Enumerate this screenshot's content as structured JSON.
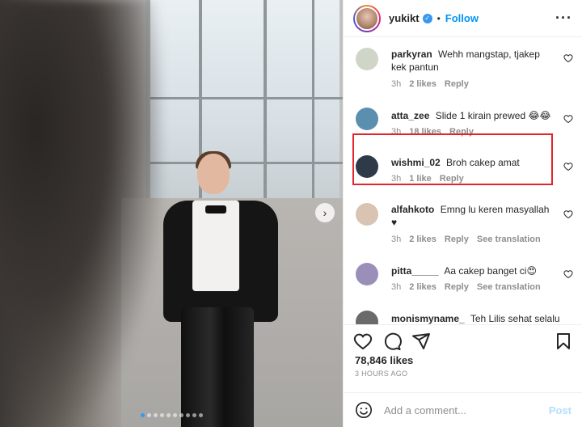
{
  "media": {
    "next_icon": "chevron-right-icon",
    "slide_count": 10,
    "active_slide": 1
  },
  "header": {
    "username": "yukikt",
    "verified_mark": "✓",
    "separator": "•",
    "follow_label": "Follow",
    "more_icon": "···"
  },
  "comments": [
    {
      "user": "parkyran",
      "text": "Wehh mangstap, tjakep kek pantun",
      "time": "3h",
      "likes": "2 likes",
      "reply": "Reply",
      "translate": "",
      "avatar_color": "#cfd6c8"
    },
    {
      "user": "atta_zee",
      "text": "Slide 1 kirain prewed 😂😂",
      "time": "3h",
      "likes": "18 likes",
      "reply": "Reply",
      "translate": "",
      "avatar_color": "#5b8fb0"
    },
    {
      "user": "wishmi_02",
      "text": "Broh cakep amat",
      "time": "3h",
      "likes": "1 like",
      "reply": "Reply",
      "translate": "",
      "avatar_color": "#2e3a48"
    },
    {
      "user": "alfahkoto",
      "text": "Emng lu keren masyallah ♥",
      "time": "3h",
      "likes": "2 likes",
      "reply": "Reply",
      "translate": "See translation",
      "avatar_color": "#d9c4b3"
    },
    {
      "user": "pitta_____",
      "text": "Aa cakep banget ci😍",
      "time": "3h",
      "likes": "2 likes",
      "reply": "Reply",
      "translate": "See translation",
      "avatar_color": "#9a8fb8"
    },
    {
      "user": "monismyname_",
      "text": "Teh Lilis sehat selalu",
      "time": "",
      "likes": "",
      "reply": "",
      "translate": "",
      "avatar_color": "#6a6a6a"
    }
  ],
  "post": {
    "likes": "78,846 likes",
    "time": "3 HOURS AGO"
  },
  "composer": {
    "placeholder": "Add a comment...",
    "post_label": "Post"
  },
  "colors": {
    "accent": "#0095f6",
    "highlight_box": "#e3242b",
    "like_heart": "#ed4956"
  }
}
